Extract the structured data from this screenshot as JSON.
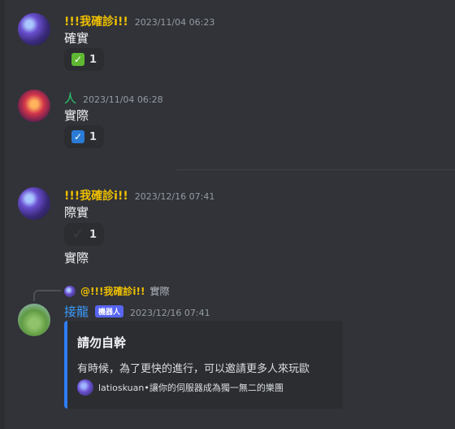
{
  "messages": [
    {
      "username": "!!!我確診i!!",
      "timestamp": "2023/11/04 06:23",
      "content": "確實",
      "reaction": {
        "emoji_icon": "white-check-mark-icon",
        "glyph": "✓",
        "count": "1"
      }
    },
    {
      "username": "人",
      "timestamp": "2023/11/04 06:28",
      "content": "實際",
      "reaction": {
        "emoji_icon": "ballot-box-check-icon",
        "glyph": "✓",
        "count": "1"
      }
    },
    {
      "username": "!!!我確診i!!",
      "timestamp": "2023/12/16 07:41",
      "content": "際實",
      "reaction": {
        "emoji_icon": "heavy-check-mark-icon",
        "glyph": "✓",
        "count": "1"
      },
      "content2": "實際"
    },
    {
      "reply_to": {
        "username": "@!!!我確診i!!",
        "text": "實際"
      },
      "username": "接龍",
      "bot_tag": "機器人",
      "timestamp": "2023/12/16 07:41",
      "embed": {
        "title": "請勿自幹",
        "description": "有時候，為了更快的進行，可以邀請更多人來玩歐",
        "footer": "latioskuan•讓你的伺服器成為獨一無二的樂團"
      }
    }
  ],
  "colors": {
    "background": "#313338",
    "gold_username": "#f0c000",
    "green_username": "#2ecc71",
    "bot_username": "#3b9dff",
    "embed_accent": "#2f7df5"
  }
}
